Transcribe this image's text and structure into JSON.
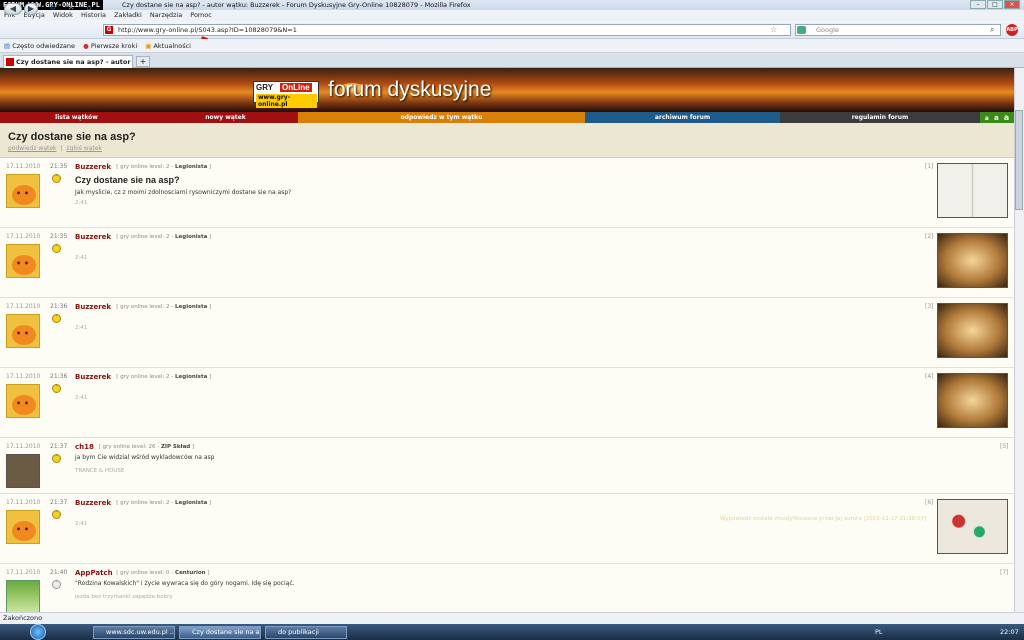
{
  "window": {
    "watermark": "FORUM WWW.GRY-ONLINE.PL",
    "title": "Czy dostane sie na asp? - autor wątku: Buzzerek - Forum Dyskusyjne Gry-Online 10828079 - Mozilla Firefox"
  },
  "menu": [
    "Plik",
    "Edycja",
    "Widok",
    "Historia",
    "Zakładki",
    "Narzędzia",
    "Pomoc"
  ],
  "nav": {
    "url": "http://www.gry-online.pl/S043.asp?ID=10828079&N=1",
    "search_placeholder": "Google"
  },
  "bookmarks": [
    "Często odwiedzane",
    "Pierwsze kroki",
    "Aktualności"
  ],
  "tab": {
    "label": "Czy dostane sie na asp? - autor wątku...",
    "plus": "+"
  },
  "site": {
    "logo_top": "GRY",
    "logo_red": "OnLine",
    "logo_url": "www.gry-online.pl",
    "title": "forum dyskusyjne"
  },
  "forum_nav": [
    {
      "label": "lista wątków",
      "color": "#a01010"
    },
    {
      "label": "nowy wątek",
      "color": "#a01010"
    },
    {
      "label": "odpowiedz w tym wątku",
      "color": "#d9800a"
    },
    {
      "label": "archiwum forum",
      "color": "#1e5a8a"
    },
    {
      "label": "regulamin forum",
      "color": "#3c3c3c"
    }
  ],
  "font_sizes": [
    "a",
    "a",
    "a"
  ],
  "thread": {
    "title": "Czy dostane sie na asp?",
    "link_reply": "podwiedz wątek",
    "sep": "|",
    "link_report": "zgłoś wątek"
  },
  "posts": [
    {
      "date": "17.11.2010",
      "time": "21:35",
      "author": "Buzzerek",
      "level": "[ gry online level: 2 - ",
      "rank": "Legionista",
      "rank_end": "]",
      "subject": "Czy dostane sie na asp?",
      "body": "Jak myslicie, cz z moimi zdolnosciami rysowniczymi dostane sie na asp?",
      "sig": "2:41",
      "num": "[1]",
      "avatar": "tiger",
      "image": "page",
      "edit": ""
    },
    {
      "date": "17.11.2010",
      "time": "21:35",
      "author": "Buzzerek",
      "level": "[ gry online level: 2 - ",
      "rank": "Legionista",
      "rank_end": "]",
      "subject": "",
      "body": "",
      "sig": "2:41",
      "num": "[2]",
      "avatar": "tiger",
      "image": "lamp",
      "edit": ""
    },
    {
      "date": "17.11.2010",
      "time": "21:36",
      "author": "Buzzerek",
      "level": "[ gry online level: 2 - ",
      "rank": "Legionista",
      "rank_end": "]",
      "subject": "",
      "body": "",
      "sig": "2:41",
      "num": "[3]",
      "avatar": "tiger",
      "image": "lamp",
      "edit": ""
    },
    {
      "date": "17.11.2010",
      "time": "21:36",
      "author": "Buzzerek",
      "level": "[ gry online level: 2 - ",
      "rank": "Legionista",
      "rank_end": "]",
      "subject": "",
      "body": "",
      "sig": "2:41",
      "num": "[4]",
      "avatar": "tiger",
      "image": "lamp",
      "edit": ""
    },
    {
      "date": "17.11.2010",
      "time": "21:37",
      "author": "ch18",
      "level": "[ gry online level: 26 - ",
      "rank": "ZIP Skład",
      "rank_end": "]",
      "subject": "",
      "body": "ja bym Cie widzial wśród wykladowców na asp",
      "sig": "TRANCE & HOUSE",
      "num": "[5]",
      "avatar": "dark",
      "image": "",
      "edit": ""
    },
    {
      "date": "17.11.2010",
      "time": "21:37",
      "author": "Buzzerek",
      "level": "[ gry online level: 2 - ",
      "rank": "Legionista",
      "rank_end": "]",
      "subject": "",
      "body": "",
      "sig": "2:41",
      "num": "[6]",
      "avatar": "tiger",
      "image": "art",
      "edit": "Wypowiedź została zmodyfikowana przez jej autora [2010-11-17 21:38:07]"
    },
    {
      "date": "17.11.2010",
      "time": "21:40",
      "author": "AppPatch",
      "level": "[ gry online level: 0 - ",
      "rank": "Centurion",
      "rank_end": "]",
      "subject": "",
      "body": "\"Rodzina Kowalskich\" i życie wywraca się do góry nogami. Idę się pociąć.",
      "sig": "jezda bez trzymanki zapędza bobry",
      "num": "[7]",
      "avatar": "green",
      "image": "",
      "edit": ""
    }
  ],
  "status": "Zakończono",
  "taskbar": {
    "items": [
      "www.sdc.uw.edu.pl ...",
      "Czy dostane sie na a...",
      "do publikacji"
    ],
    "lang": "PL",
    "clock": "22:07"
  }
}
